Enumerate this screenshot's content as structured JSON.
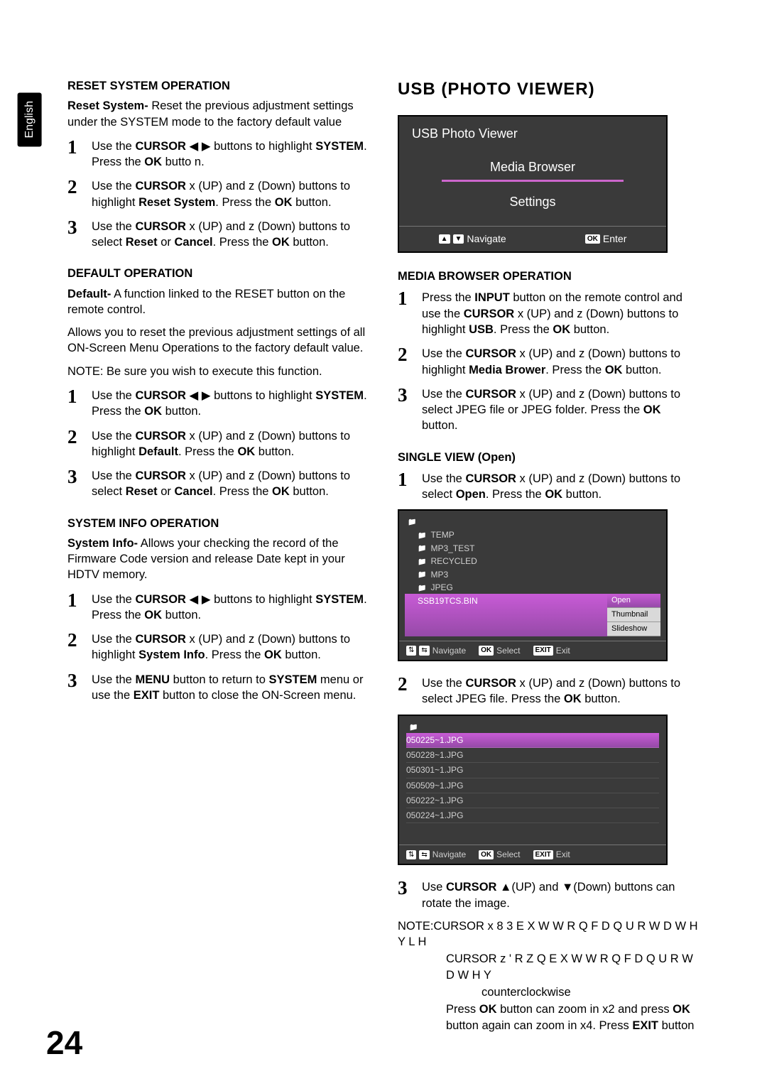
{
  "tab": "English",
  "page_number": "24",
  "left": {
    "reset": {
      "title": "RESET SYSTEM OPERATION",
      "intro_strong": "Reset System-",
      "intro_rest": " Reset the previous adjustment settings under the SYSTEM mode to the factory default value",
      "steps": [
        "Use the CURSOR ◀ ▶ buttons to highlight SYSTEM. Press the OK butto n.",
        "Use the CURSOR  x (UP) and  z (Down) buttons to highlight Reset System. Press the OK button.",
        "Use the CURSOR  x (UP) and  z (Down) buttons to select Reset or Cancel. Press the OK button."
      ]
    },
    "default": {
      "title": "DEFAULT OPERATION",
      "p1_strong": "Default-",
      "p1_rest": " A function linked to the RESET button on the remote control.",
      "p2": "Allows you to reset the previous adjustment settings of all ON-Screen Menu Operations to the factory default value.",
      "note": "NOTE:  Be sure you wish to execute this function.",
      "steps": [
        "Use the CURSOR ◀ ▶ buttons to highlight SYSTEM. Press the OK button.",
        "Use the CURSOR  x (UP) and  z (Down) buttons to highlight Default. Press the OK button.",
        "Use the CURSOR  x (UP) and  z (Down) buttons to select Reset or Cancel. Press the OK button."
      ]
    },
    "sysinfo": {
      "title": "SYSTEM INFO OPERATION",
      "p_strong": "System Info-",
      "p_rest": " Allows your checking the record of the Firmware Code version and release Date kept in your HDTV memory.",
      "steps": [
        "Use the CURSOR ◀ ▶ buttons to highlight SYSTEM. Press the OK button.",
        "Use the CURSOR  x (UP) and  z (Down) buttons to highlight System Info. Press the OK button.",
        "Use the MENU button to return to SYSTEM menu or use the EXIT button to close the ON-Screen menu."
      ]
    }
  },
  "right": {
    "usb_title": "USB (PHOTO VIEWER)",
    "menu": {
      "header": "USB Photo Viewer",
      "items": [
        "Media Browser",
        "Settings"
      ],
      "footer_nav": "Navigate",
      "footer_enter": "Enter"
    },
    "media": {
      "title": "MEDIA BROWSER OPERATION",
      "steps": [
        "Press the INPUT button on the remote control and use the CURSOR  x (UP) and  z (Down) buttons to highlight USB. Press the OK button.",
        "Use the CURSOR  x (UP) and  z (Down) buttons to highlight Media Brower. Press the OK button.",
        "Use the CURSOR  x (UP) and  z (Down) buttons to select JPEG file or JPEG folder. Press the OK button."
      ]
    },
    "single_title": "SINGLE VIEW (Open)",
    "single_step1": "Use the CURSOR  x (UP) and  z (Down) buttons to select Open. Press the OK button.",
    "browser1": {
      "folders": [
        "TEMP",
        "MP3_TEST",
        "RECYCLED",
        "MP3",
        "JPEG"
      ],
      "selected": "SSB19TCS.BIN",
      "submenu": [
        "Open",
        "Thumbnail",
        "Slideshow"
      ],
      "footer": {
        "nav": "Navigate",
        "sel": "Select",
        "exit": "Exit"
      }
    },
    "single_step2": "Use the CURSOR  x (UP) and  z (Down) buttons to select JPEG file. Press the OK button.",
    "browser2": {
      "files": [
        "050225~1.JPG",
        "050228~1.JPG",
        "050301~1.JPG",
        "050509~1.JPG",
        "050222~1.JPG",
        "050224~1.JPG"
      ],
      "footer": {
        "nav": "Navigate",
        "sel": "Select",
        "exit": "Exit"
      }
    },
    "single_step3": "Use CURSOR ▲(UP) and ▼(Down) buttons can rotate the image.",
    "notes": {
      "l1": "NOTE:CURSOR  x   8 3    E X W W R Q  F D Q  U R W D W H  Y L H",
      "l2": "CURSOR  z  ' R Z Q    E X W W R Q  F D Q  U R W D W H  Y",
      "l3": "counterclockwise",
      "l4": "Press OK button can zoom in x2 and press OK button again can zoom in x4. Press EXIT button"
    }
  }
}
